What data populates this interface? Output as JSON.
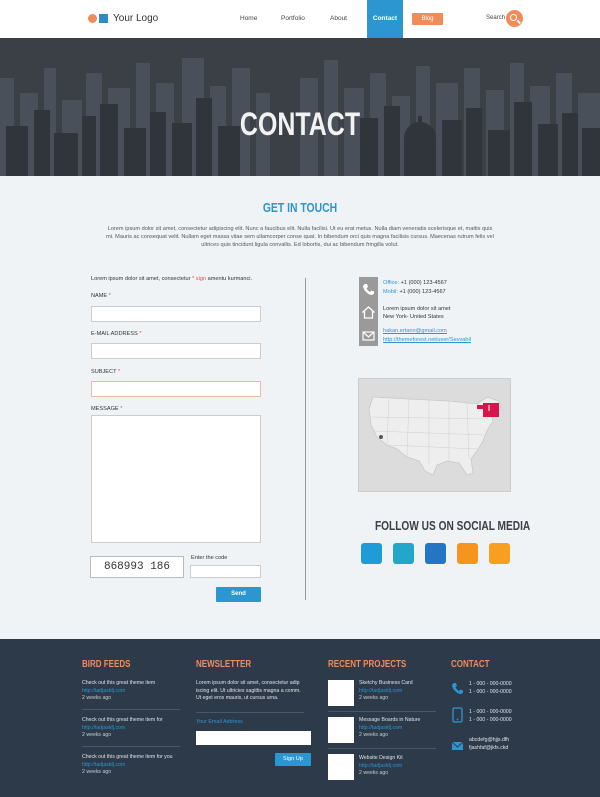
{
  "header": {
    "logo_text": "Your Logo",
    "nav": [
      "Home",
      "Portfolio",
      "About"
    ],
    "nav_active": "Contact",
    "nav_blog": "Blog",
    "search_label": "Search"
  },
  "hero": {
    "title": "CONTACT"
  },
  "main": {
    "heading": "GET IN TOUCH",
    "intro": "Lorem ipsum dolor sit amet, consectetur adipiscing elit. Nunc a faucibus elit. Nulla facilisi. Ut eu erat metus. Nulla diam venenatis scelerisque et, mattis quis mi. Mauris ac consequat velit. Nullam eget massa vitae sem ullamcorper conse quat. In bibendum orci quis magna facilisis cursus. Maecenas rutrum felis vel ultrices quis tincidunt ligula convallis. Ed lobortis, dui ac bibendum fringilla volut."
  },
  "form": {
    "note_before": "Lorem ipsum dolor sit amet, consectetur ",
    "note_star": "*",
    "note_sign": "sign",
    "note_after": " amentu kurmanci.",
    "name_label": "NAME",
    "email_label": "E-MAIL ADDRESS",
    "subject_label": "SUBJECT",
    "message_label": "MESSAGE",
    "required": "*",
    "captcha": "868993 186",
    "code_label": "Enter the code",
    "send": "Send"
  },
  "contact_info": {
    "office_label": "Office:",
    "office": "+1 (000) 123-4567",
    "mobile_label": "Mobil:",
    "mobile": "+1 (000) 123-4567",
    "address1": "Lorem ipsum dolor sit amet",
    "address2": "New York- United States",
    "email": "hakan.ertann@gmail.com",
    "url": "http://themeforest.net/user/Sevvahil"
  },
  "social": {
    "heading": "FOLLOW US ON SOCIAL MEDIA",
    "colors": [
      "#1f9bd7",
      "#22a6c9",
      "#2276c3",
      "#f7941d",
      "#f7a020"
    ]
  },
  "footer": {
    "bird": {
      "heading": "BIRD FEEDS",
      "items": [
        {
          "text": "Check out this great theme item",
          "link": "http://tadjaskfj.com",
          "date": "2 weeks ago"
        },
        {
          "text": "Check out this great theme item for",
          "link": "http://tadjaskfj.com",
          "date": "2 weeks ago"
        },
        {
          "text": "Check out this great theme item for you",
          "link": "http://tadjaskfj.com",
          "date": "2 weeks ago"
        }
      ]
    },
    "newsletter": {
      "heading": "NEWSLETTER",
      "text1": "Lorem ipsum dolor sit amet, consectetur adip",
      "text2": "iscing elit. Ut ultricies sagittis magna a comm.",
      "text3": "Ut eget eros mauris, ut cursus urna.",
      "email_label": "Your Email Address",
      "button": "Sign Up"
    },
    "projects": {
      "heading": "RECENT PROJECTS",
      "items": [
        {
          "title": "Sketchy Business Card",
          "link": "http://tadjaskfj.com",
          "date": "2 weeks ago"
        },
        {
          "title": "Message Boards in Nature",
          "link": "http://tadjaskfj.com",
          "date": "2 weeks ago"
        },
        {
          "title": "Website Design Kit",
          "link": "http://tadjaskfj.com",
          "date": "2 weeks ago"
        }
      ]
    },
    "contact": {
      "heading": "CONTACT",
      "phone1": "1 - 000 - 000-0000",
      "phone2": "1 - 000 - 000-0000",
      "mobile1": "1 - 000 - 000-0000",
      "mobile2": "1 - 000 - 000-0000",
      "email1": "abcdefg@hjjs.dfh",
      "email2": "fjashfaf@jkfs.ckd"
    }
  }
}
